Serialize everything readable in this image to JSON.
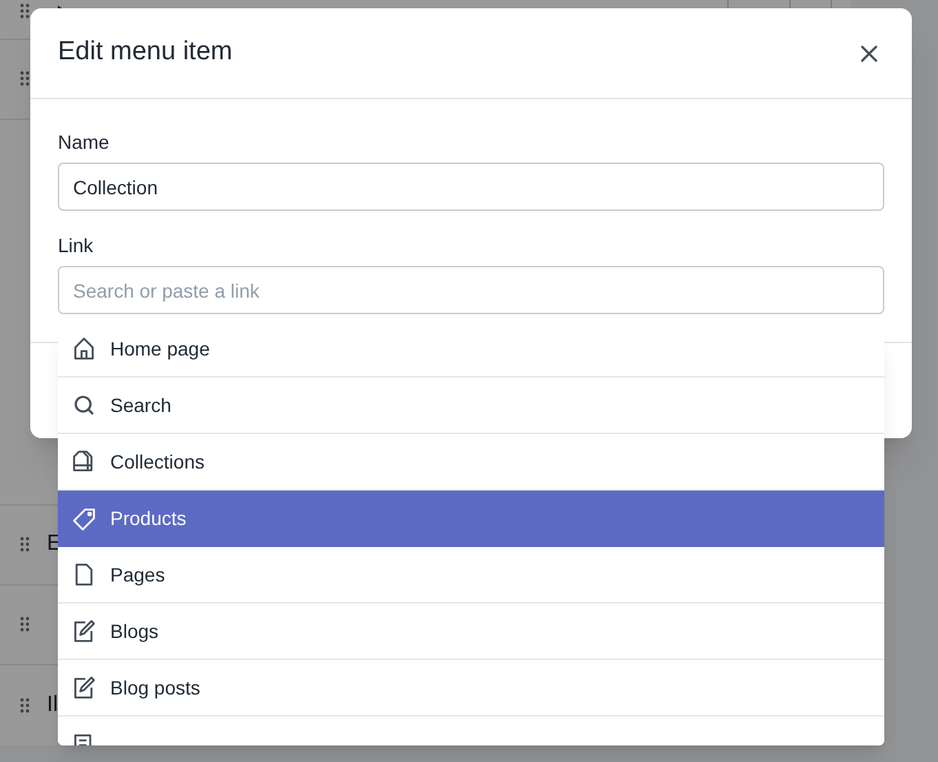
{
  "background": {
    "rows": [
      {
        "title": "E"
      },
      {
        "title": "Il"
      }
    ]
  },
  "modal": {
    "title": "Edit menu item",
    "fields": [
      {
        "label": "Name",
        "value": "Collection"
      },
      {
        "label": "Link",
        "placeholder": "Search or paste a link"
      }
    ]
  },
  "dropdown": {
    "items": [
      {
        "kind": "home",
        "label": "Home page",
        "selected": false
      },
      {
        "kind": "search",
        "label": "Search",
        "selected": false
      },
      {
        "kind": "collection",
        "label": "Collections",
        "selected": false
      },
      {
        "kind": "tag",
        "label": "Products",
        "selected": true
      },
      {
        "kind": "page",
        "label": "Pages",
        "selected": false
      },
      {
        "kind": "blog",
        "label": "Blogs",
        "selected": false
      },
      {
        "kind": "blog",
        "label": "Blog posts",
        "selected": false
      },
      {
        "kind": "policy",
        "selected": false
      }
    ]
  }
}
